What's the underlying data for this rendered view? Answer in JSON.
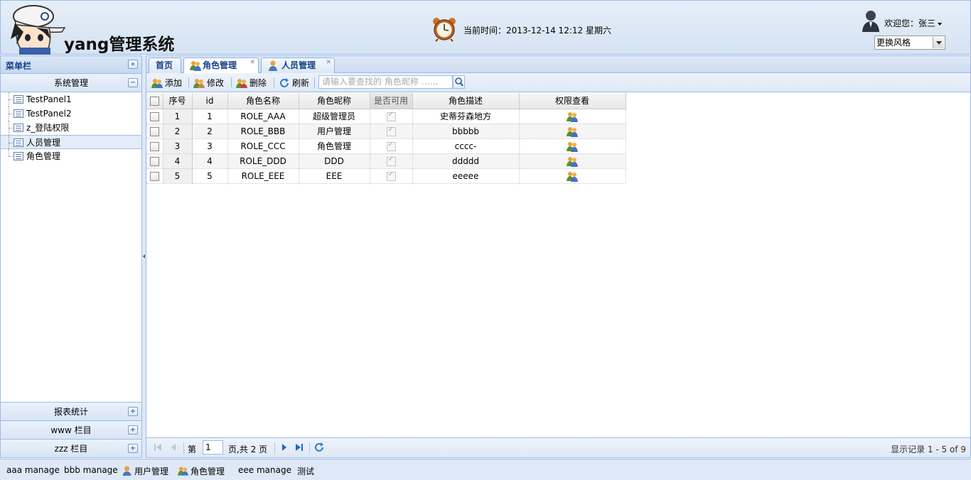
{
  "header": {
    "app_title": "yang管理系统",
    "current_time": "当前时间：2013-12-14 12:12 星期六",
    "welcome": "欢迎您：张三",
    "style_select_value": "更换风格"
  },
  "sidebar": {
    "title": "菜单栏",
    "sections": [
      {
        "label": "系统管理",
        "expanded": true
      },
      {
        "label": "报表统计",
        "expanded": false
      },
      {
        "label": "www 栏目",
        "expanded": false
      },
      {
        "label": "zzz 栏目",
        "expanded": false
      }
    ],
    "tree_items": [
      "TestPanel1",
      "TestPanel2",
      "z_登陆权限",
      "人员管理",
      "角色管理"
    ],
    "selected_item": "人员管理"
  },
  "tabs": [
    {
      "label": "首页",
      "closable": false,
      "active": false
    },
    {
      "label": "角色管理",
      "closable": true,
      "active": true
    },
    {
      "label": "人员管理",
      "closable": true,
      "active": false
    }
  ],
  "toolbar": {
    "add": "添加",
    "edit": "修改",
    "delete": "删除",
    "refresh": "刷新",
    "search_placeholder": "请输入要查找的 角色昵称 ……"
  },
  "grid": {
    "columns": [
      "序号",
      "id",
      "角色名称",
      "角色昵称",
      "是否可用",
      "角色描述",
      "权限查看"
    ],
    "rows": [
      {
        "no": "1",
        "id": "1",
        "name": "ROLE_AAA",
        "nick": "超级管理员",
        "desc": "史蒂芬森地方"
      },
      {
        "no": "2",
        "id": "2",
        "name": "ROLE_BBB",
        "nick": "用户管理",
        "desc": "bbbbb"
      },
      {
        "no": "3",
        "id": "3",
        "name": "ROLE_CCC",
        "nick": "角色管理",
        "desc": "cccc-"
      },
      {
        "no": "4",
        "id": "4",
        "name": "ROLE_DDD",
        "nick": "DDD",
        "desc": "ddddd"
      },
      {
        "no": "5",
        "id": "5",
        "name": "ROLE_EEE",
        "nick": "EEE",
        "desc": "eeeee"
      }
    ]
  },
  "pager": {
    "page_prefix": "第",
    "page_value": "1",
    "page_suffix": "页,共 2 页",
    "record_info": "显示记录 1 - 5 of 9"
  },
  "taskbar": [
    {
      "label": "aaa manage",
      "icon": ""
    },
    {
      "label": "bbb manage",
      "icon": ""
    },
    {
      "label": "用户管理",
      "icon": "user-icon"
    },
    {
      "label": "角色管理",
      "icon": "users-icon"
    },
    {
      "label": "eee manage",
      "icon": ""
    },
    {
      "label": "测试",
      "icon": ""
    }
  ],
  "colors": {
    "accent": "#15428b",
    "border": "#99bbe8",
    "header_bg": "#d5e3f3"
  }
}
